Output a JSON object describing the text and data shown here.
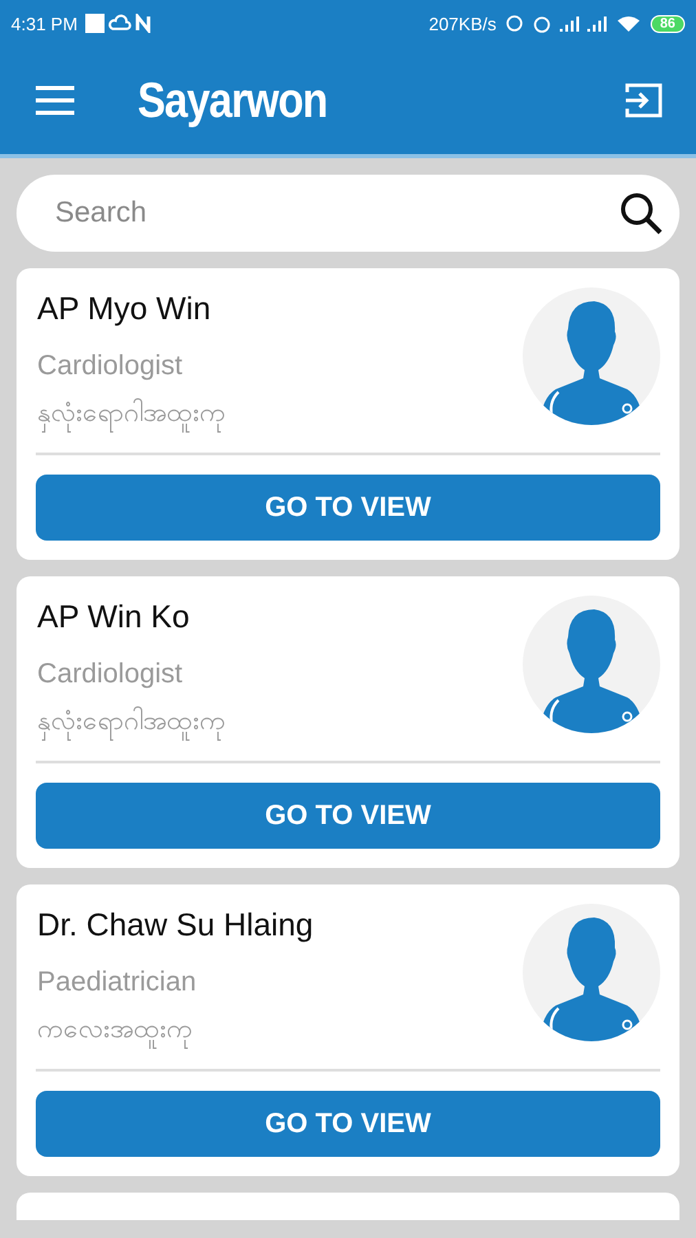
{
  "status_bar": {
    "time": "4:31 PM",
    "speed": "207KB/s",
    "battery": "86"
  },
  "app_bar": {
    "title": "Sayarwon"
  },
  "search": {
    "placeholder": "Search"
  },
  "doctors": [
    {
      "name": "AP Myo Win",
      "specialty": "Cardiologist",
      "specialty_local": "နှလုံးရောဂါအထူးကု",
      "button": "GO TO VIEW"
    },
    {
      "name": "AP Win Ko",
      "specialty": "Cardiologist",
      "specialty_local": "နှလုံးရောဂါအထူးကု",
      "button": "GO TO VIEW"
    },
    {
      "name": "Dr. Chaw Su Hlaing",
      "specialty": "Paediatrician",
      "specialty_local": "ကလေးအထူးကု",
      "button": "GO TO VIEW"
    }
  ]
}
